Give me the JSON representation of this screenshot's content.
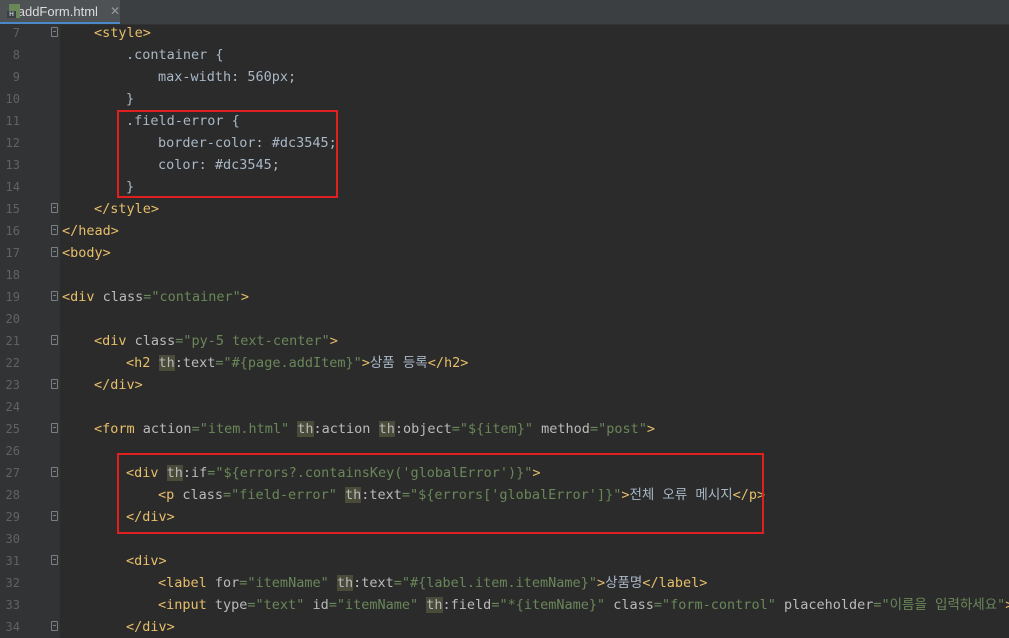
{
  "tab": {
    "label": "addForm.html",
    "icon": "html-file-icon"
  },
  "colors": {
    "background": "#2b2b2b",
    "tag": "#e8bf6a",
    "attr": "#bababa",
    "value": "#6a8759",
    "highlight_box": "#e02020"
  },
  "lines": [
    {
      "n": "7",
      "indent": 1,
      "fold": true,
      "html": "<span class=\"t\">&lt;style&gt;</span>"
    },
    {
      "n": "8",
      "indent": 2,
      "fold": false,
      "html": "<span class=\"sel\">.container {</span>"
    },
    {
      "n": "9",
      "indent": 3,
      "fold": false,
      "html": "<span class=\"sel\">max-width: 560px;</span>"
    },
    {
      "n": "10",
      "indent": 2,
      "fold": false,
      "html": "<span class=\"sel\">}</span>"
    },
    {
      "n": "11",
      "indent": 2,
      "fold": false,
      "html": "<span class=\"sel\">.field-error {</span>"
    },
    {
      "n": "12",
      "indent": 3,
      "fold": false,
      "html": "<span class=\"sel\">border-color: #dc3545;</span>"
    },
    {
      "n": "13",
      "indent": 3,
      "fold": false,
      "html": "<span class=\"sel\">color: #dc3545;</span>"
    },
    {
      "n": "14",
      "indent": 2,
      "fold": false,
      "html": "<span class=\"sel\">}</span>"
    },
    {
      "n": "15",
      "indent": 1,
      "fold": true,
      "html": "<span class=\"t\">&lt;/style&gt;</span>"
    },
    {
      "n": "16",
      "indent": 0,
      "fold": true,
      "html": "<span class=\"t\">&lt;/head&gt;</span>"
    },
    {
      "n": "17",
      "indent": 0,
      "fold": true,
      "html": "<span class=\"t\">&lt;body&gt;</span>"
    },
    {
      "n": "18",
      "indent": 0,
      "fold": false,
      "html": ""
    },
    {
      "n": "19",
      "indent": 0,
      "fold": true,
      "html": "<span class=\"t\">&lt;div </span><span class=\"a\">class</span><span class=\"v\">=\"container\"</span><span class=\"t\">&gt;</span>"
    },
    {
      "n": "20",
      "indent": 0,
      "fold": false,
      "html": ""
    },
    {
      "n": "21",
      "indent": 1,
      "fold": true,
      "html": "<span class=\"t\">&lt;div </span><span class=\"a\">class</span><span class=\"v\">=\"py-5 text-center\"</span><span class=\"t\">&gt;</span>"
    },
    {
      "n": "22",
      "indent": 2,
      "fold": false,
      "html": "<span class=\"t\">&lt;h2 </span><span class=\"ns\">th</span><span class=\"a\">:text</span><span class=\"v\">=\"#{page.addItem}\"</span><span class=\"t\">&gt;</span><span class=\"x\">상품 등록</span><span class=\"t\">&lt;/h2&gt;</span>"
    },
    {
      "n": "23",
      "indent": 1,
      "fold": true,
      "html": "<span class=\"t\">&lt;/div&gt;</span>"
    },
    {
      "n": "24",
      "indent": 0,
      "fold": false,
      "html": ""
    },
    {
      "n": "25",
      "indent": 1,
      "fold": true,
      "html": "<span class=\"t\">&lt;form </span><span class=\"a\">action</span><span class=\"v\">=\"item.html\"</span> <span class=\"ns\">th</span><span class=\"a\">:action</span> <span class=\"ns\">th</span><span class=\"a\">:object</span><span class=\"v\">=\"${item}\"</span> <span class=\"a\">method</span><span class=\"v\">=\"post\"</span><span class=\"t\">&gt;</span>"
    },
    {
      "n": "26",
      "indent": 0,
      "fold": false,
      "html": ""
    },
    {
      "n": "27",
      "indent": 2,
      "fold": true,
      "html": "<span class=\"t\">&lt;div </span><span class=\"ns\">th</span><span class=\"a\">:if</span><span class=\"v\">=\"${errors?.containsKey('globalError')}\"</span><span class=\"t\">&gt;</span>"
    },
    {
      "n": "28",
      "indent": 3,
      "fold": false,
      "html": "<span class=\"t\">&lt;p </span><span class=\"a\">class</span><span class=\"v\">=\"field-error\"</span> <span class=\"ns\">th</span><span class=\"a\">:text</span><span class=\"v\">=\"${errors['globalError']}\"</span><span class=\"t\">&gt;</span><span class=\"x\">전체 오류 메시지</span><span class=\"t\">&lt;/p&gt;</span>"
    },
    {
      "n": "29",
      "indent": 2,
      "fold": true,
      "html": "<span class=\"t\">&lt;/div&gt;</span>"
    },
    {
      "n": "30",
      "indent": 0,
      "fold": false,
      "html": ""
    },
    {
      "n": "31",
      "indent": 2,
      "fold": true,
      "html": "<span class=\"t\">&lt;div&gt;</span>"
    },
    {
      "n": "32",
      "indent": 3,
      "fold": false,
      "html": "<span class=\"t\">&lt;label </span><span class=\"a\">for</span><span class=\"v\">=\"itemName\"</span> <span class=\"ns\">th</span><span class=\"a\">:text</span><span class=\"v\">=\"#{label.item.itemName}\"</span><span class=\"t\">&gt;</span><span class=\"x\">상품명</span><span class=\"t\">&lt;/label&gt;</span>"
    },
    {
      "n": "33",
      "indent": 3,
      "fold": false,
      "html": "<span class=\"t\">&lt;input </span><span class=\"a\">type</span><span class=\"v\">=\"text\"</span> <span class=\"a\">id</span><span class=\"v\">=\"itemName\"</span> <span class=\"ns\">th</span><span class=\"a\">:field</span><span class=\"v\">=\"*{itemName}\"</span> <span class=\"a\">class</span><span class=\"v\">=\"form-control\"</span> <span class=\"a\">placeholder</span><span class=\"v\">=\"이름을 입력하세요\"</span><span class=\"t\">&gt;</span>"
    },
    {
      "n": "34",
      "indent": 2,
      "fold": true,
      "html": "<span class=\"t\">&lt;/div&gt;</span>"
    }
  ]
}
